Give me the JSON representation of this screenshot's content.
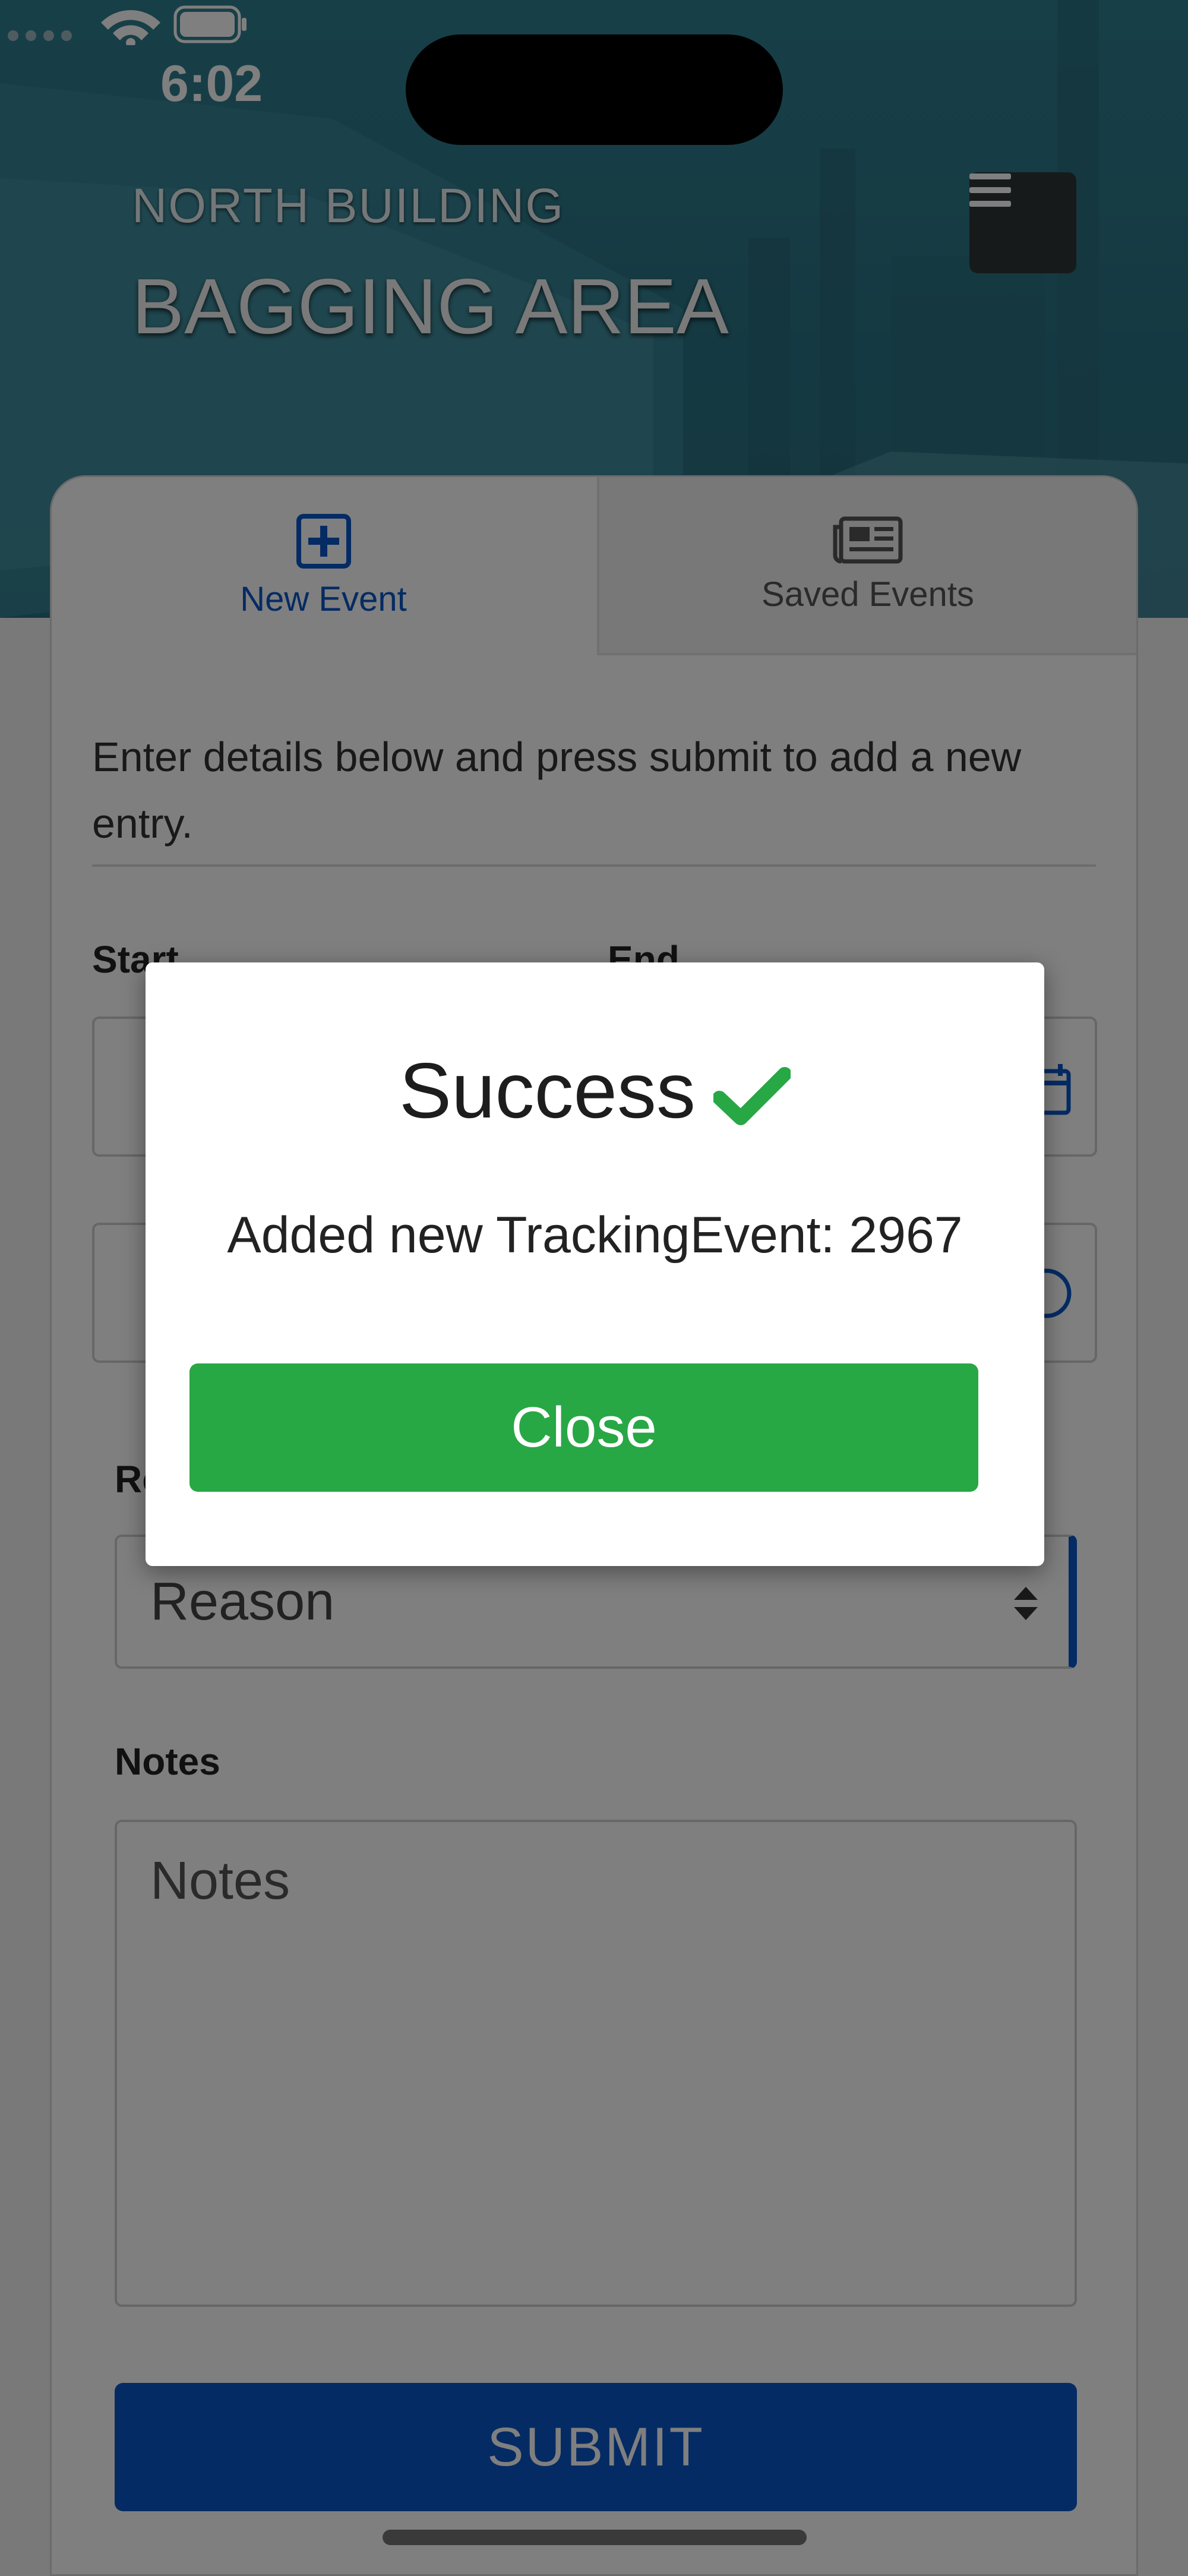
{
  "status_bar": {
    "time": "6:02"
  },
  "header": {
    "building": "NORTH BUILDING",
    "area": "BAGGING AREA",
    "menu_icon": "hamburger-icon"
  },
  "tabs": [
    {
      "label": "New Event",
      "icon": "plus-square-icon",
      "active": true
    },
    {
      "label": "Saved Events",
      "icon": "newspaper-icon",
      "active": false
    }
  ],
  "form": {
    "intro": "Enter details below and press submit to add a new entry.",
    "start_label": "Start",
    "end_label": "End",
    "reason_label": "Reason",
    "reason_value": "Reason",
    "notes_label": "Notes",
    "notes_placeholder": "Notes",
    "submit_label": "SUBMIT"
  },
  "modal": {
    "title": "Success",
    "message": "Added new TrackingEvent: 2967",
    "close_label": "Close",
    "check_color": "#28a745"
  },
  "colors": {
    "primary": "#0a56c8",
    "success": "#28a745"
  }
}
